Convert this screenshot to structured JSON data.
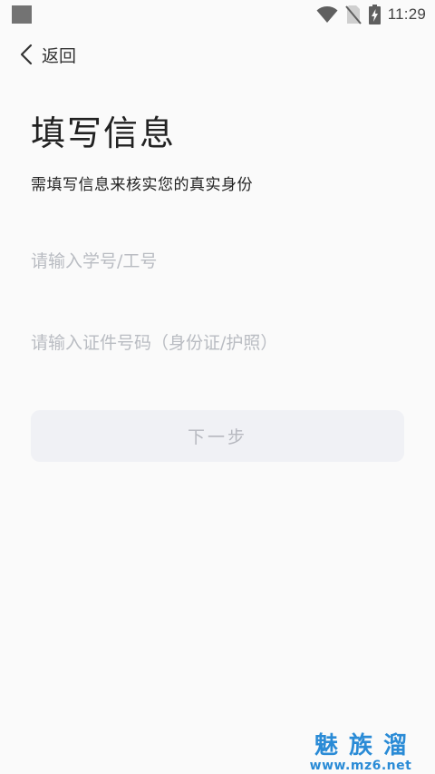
{
  "status_bar": {
    "time": "11:29",
    "icons": [
      "wifi-icon",
      "no-sim-icon",
      "battery-charging-icon"
    ]
  },
  "nav": {
    "back_label": "返回",
    "back_icon": "chevron-left-icon"
  },
  "page": {
    "title": "填写信息",
    "subtitle": "需填写信息来核实您的真实身份"
  },
  "form": {
    "id_field": {
      "placeholder": "请输入学号/工号",
      "value": ""
    },
    "cert_field": {
      "placeholder": "请输入证件号码（身份证/护照）",
      "value": ""
    },
    "next_label": "下一步"
  },
  "watermark": {
    "main": "魅族溜",
    "url": "www.mz6.net"
  },
  "colors": {
    "background": "#fafafa",
    "button_bg": "#f0f1f5",
    "button_text": "#b6b8bf",
    "placeholder": "#b9bcc2",
    "watermark": "#2a8bd6"
  }
}
